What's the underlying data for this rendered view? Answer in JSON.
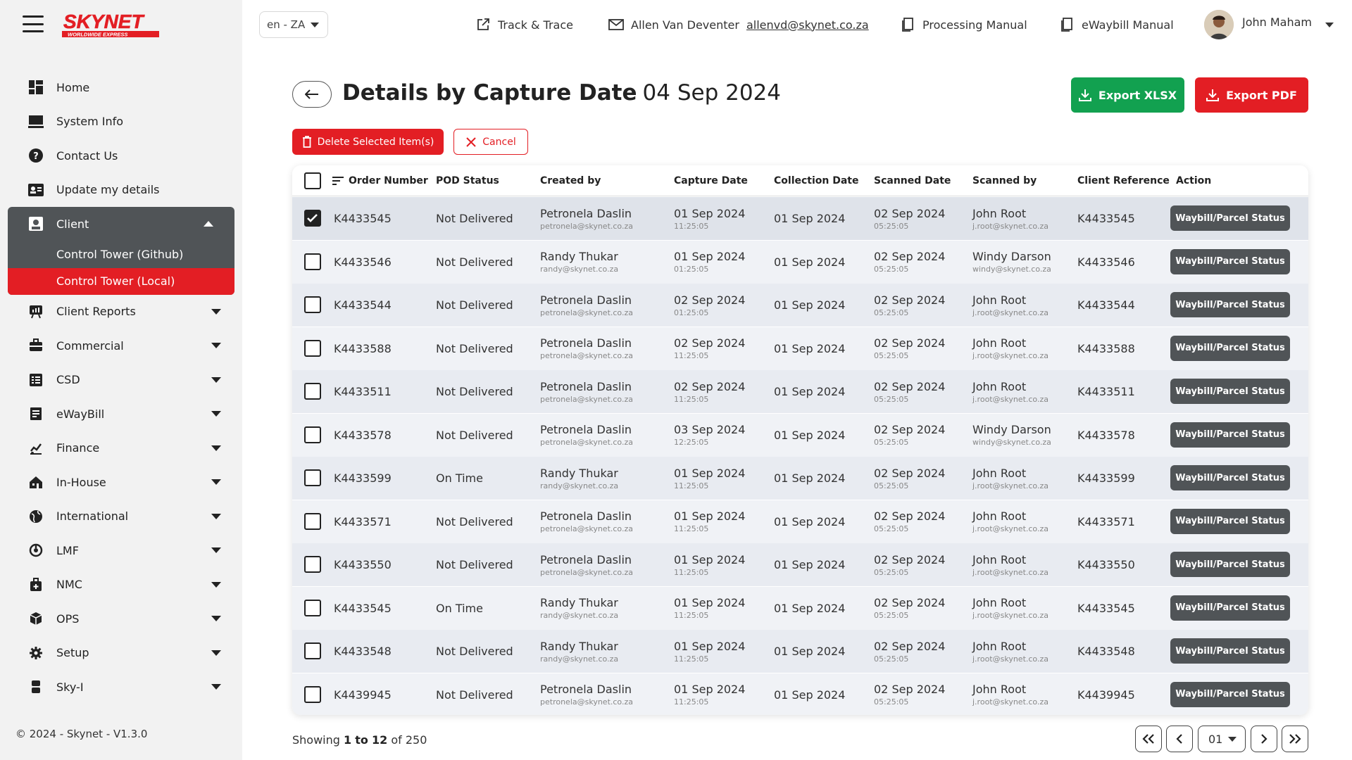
{
  "brand": {
    "logo_text": "SKYNET",
    "logo_sub": "WORLDWIDE EXPRESS",
    "accent": "#e31e24",
    "dark": "#505457",
    "green": "#12a150"
  },
  "sidebar": {
    "items": [
      {
        "label": "Home",
        "icon": "dashboard-icon"
      },
      {
        "label": "System Info",
        "icon": "monitor-icon"
      },
      {
        "label": "Contact Us",
        "icon": "help-icon"
      },
      {
        "label": "Update my details",
        "icon": "id-card-icon"
      }
    ],
    "client": {
      "label": "Client",
      "sub": [
        "Control Tower (Github)",
        "Control Tower (Local)"
      ]
    },
    "groups": [
      {
        "label": "Client Reports",
        "icon": "report-icon"
      },
      {
        "label": "Commercial",
        "icon": "briefcase-icon"
      },
      {
        "label": "CSD",
        "icon": "list-icon"
      },
      {
        "label": "eWayBill",
        "icon": "receipt-icon"
      },
      {
        "label": "Finance",
        "icon": "finance-icon"
      },
      {
        "label": "In-House",
        "icon": "house-icon"
      },
      {
        "label": "International",
        "icon": "globe-icon"
      },
      {
        "label": "LMF",
        "icon": "lmf-icon"
      },
      {
        "label": "NMC",
        "icon": "nmc-icon"
      },
      {
        "label": "OPS",
        "icon": "box-icon"
      },
      {
        "label": "Setup",
        "icon": "gear-icon"
      },
      {
        "label": "Sky-I",
        "icon": "server-icon"
      }
    ],
    "copyright": "© 2024 - Skynet - V1.3.0"
  },
  "header": {
    "lang": "en - ZA",
    "track": "Track & Trace",
    "contact_name": "Allen Van Deventer",
    "contact_email": "allenvd@skynet.co.za",
    "processing_manual": "Processing Manual",
    "ewaybill_manual": "eWaybill Manual",
    "user": "John Maham"
  },
  "page": {
    "title": "Details by Capture Date",
    "date": "04 Sep 2024",
    "export_xlsx": "Export XLSX",
    "export_pdf": "Export PDF",
    "delete_label": "Delete Selected Item(s)",
    "cancel_label": "Cancel"
  },
  "table": {
    "columns": [
      "Order Number",
      "POD Status",
      "Created by",
      "Capture Date",
      "Collection Date",
      "Scanned Date",
      "Scanned by",
      "Client Reference",
      "Action"
    ],
    "action_label": "Waybill/Parcel Status",
    "rows": [
      {
        "checked": true,
        "order": "K4433545",
        "status": "Not Delivered",
        "creator": "Petronela Daslin",
        "creator_email": "petronela@skynet.co.za",
        "capture_date": "01 Sep 2024",
        "capture_time": "11:25:05",
        "collection_date": "01 Sep 2024",
        "scanned_date": "02 Sep 2024",
        "scanned_time": "05:25:05",
        "scanner": "John Root",
        "scanner_email": "j.root@skynet.co.za",
        "client_ref": "K4433545"
      },
      {
        "checked": false,
        "order": "K4433546",
        "status": "Not Delivered",
        "creator": "Randy Thukar",
        "creator_email": "randy@skynet.co.za",
        "capture_date": "01 Sep 2024",
        "capture_time": "01:25:05",
        "collection_date": "01 Sep 2024",
        "scanned_date": "02 Sep 2024",
        "scanned_time": "05:25:05",
        "scanner": "Windy Darson",
        "scanner_email": "windy@skynet.co.za",
        "client_ref": "K4433546"
      },
      {
        "checked": false,
        "order": "K4433544",
        "status": "Not Delivered",
        "creator": "Petronela Daslin",
        "creator_email": "petronela@skynet.co.za",
        "capture_date": "02 Sep 2024",
        "capture_time": "01:25:05",
        "collection_date": "01 Sep 2024",
        "scanned_date": "02 Sep 2024",
        "scanned_time": "05:25:05",
        "scanner": "John Root",
        "scanner_email": "j.root@skynet.co.za",
        "client_ref": "K4433544"
      },
      {
        "checked": false,
        "order": "K4433588",
        "status": "Not Delivered",
        "creator": "Petronela Daslin",
        "creator_email": "petronela@skynet.co.za",
        "capture_date": "02 Sep 2024",
        "capture_time": "11:25:05",
        "collection_date": "01 Sep 2024",
        "scanned_date": "02 Sep 2024",
        "scanned_time": "05:25:05",
        "scanner": "John Root",
        "scanner_email": "j.root@skynet.co.za",
        "client_ref": "K4433588"
      },
      {
        "checked": false,
        "order": "K4433511",
        "status": "Not Delivered",
        "creator": "Petronela Daslin",
        "creator_email": "petronela@skynet.co.za",
        "capture_date": "02 Sep 2024",
        "capture_time": "11:25:05",
        "collection_date": "01 Sep 2024",
        "scanned_date": "02 Sep 2024",
        "scanned_time": "05:25:05",
        "scanner": "John Root",
        "scanner_email": "j.root@skynet.co.za",
        "client_ref": "K4433511"
      },
      {
        "checked": false,
        "order": "K4433578",
        "status": "Not Delivered",
        "creator": "Petronela Daslin",
        "creator_email": "petronela@skynet.co.za",
        "capture_date": "03 Sep 2024",
        "capture_time": "12:25:05",
        "collection_date": "01 Sep 2024",
        "scanned_date": "02 Sep 2024",
        "scanned_time": "05:25:05",
        "scanner": "Windy Darson",
        "scanner_email": "windy@skynet.co.za",
        "client_ref": "K4433578"
      },
      {
        "checked": false,
        "order": "K4433599",
        "status": "On Time",
        "creator": "Randy Thukar",
        "creator_email": "randy@skynet.co.za",
        "capture_date": "01 Sep 2024",
        "capture_time": "11:25:05",
        "collection_date": "01 Sep 2024",
        "scanned_date": "02 Sep 2024",
        "scanned_time": "05:25:05",
        "scanner": "John Root",
        "scanner_email": "j.root@skynet.co.za",
        "client_ref": "K4433599"
      },
      {
        "checked": false,
        "order": "K4433571",
        "status": "Not Delivered",
        "creator": "Petronela Daslin",
        "creator_email": "petronela@skynet.co.za",
        "capture_date": "01 Sep 2024",
        "capture_time": "11:25:05",
        "collection_date": "01 Sep 2024",
        "scanned_date": "02 Sep 2024",
        "scanned_time": "05:25:05",
        "scanner": "John Root",
        "scanner_email": "j.root@skynet.co.za",
        "client_ref": "K4433571"
      },
      {
        "checked": false,
        "order": "K4433550",
        "status": "Not Delivered",
        "creator": "Petronela Daslin",
        "creator_email": "petronela@skynet.co.za",
        "capture_date": "01 Sep 2024",
        "capture_time": "11:25:05",
        "collection_date": "01 Sep 2024",
        "scanned_date": "02 Sep 2024",
        "scanned_time": "05:25:05",
        "scanner": "John Root",
        "scanner_email": "j.root@skynet.co.za",
        "client_ref": "K4433550"
      },
      {
        "checked": false,
        "order": "K4433545",
        "status": "On Time",
        "creator": "Randy Thukar",
        "creator_email": "randy@skynet.co.za",
        "capture_date": "01 Sep 2024",
        "capture_time": "11:25:05",
        "collection_date": "01 Sep 2024",
        "scanned_date": "02 Sep 2024",
        "scanned_time": "05:25:05",
        "scanner": "John Root",
        "scanner_email": "j.root@skynet.co.za",
        "client_ref": "K4433545"
      },
      {
        "checked": false,
        "order": "K4433548",
        "status": "Not Delivered",
        "creator": "Randy Thukar",
        "creator_email": "randy@skynet.co.za",
        "capture_date": "01 Sep 2024",
        "capture_time": "11:25:05",
        "collection_date": "01 Sep 2024",
        "scanned_date": "02 Sep 2024",
        "scanned_time": "05:25:05",
        "scanner": "John Root",
        "scanner_email": "j.root@skynet.co.za",
        "client_ref": "K4433548"
      },
      {
        "checked": false,
        "order": "K4439945",
        "status": "Not Delivered",
        "creator": "Petronela Daslin",
        "creator_email": "petronela@skynet.co.za",
        "capture_date": "01 Sep 2024",
        "capture_time": "11:25:05",
        "collection_date": "01 Sep 2024",
        "scanned_date": "02 Sep 2024",
        "scanned_time": "05:25:05",
        "scanner": "John Root",
        "scanner_email": "j.root@skynet.co.za",
        "client_ref": "K4439945"
      }
    ]
  },
  "pagination": {
    "prefix": "Showing",
    "from": "1",
    "to_word": "to",
    "to": "12",
    "of_word": "of",
    "total": "250",
    "page": "01"
  }
}
